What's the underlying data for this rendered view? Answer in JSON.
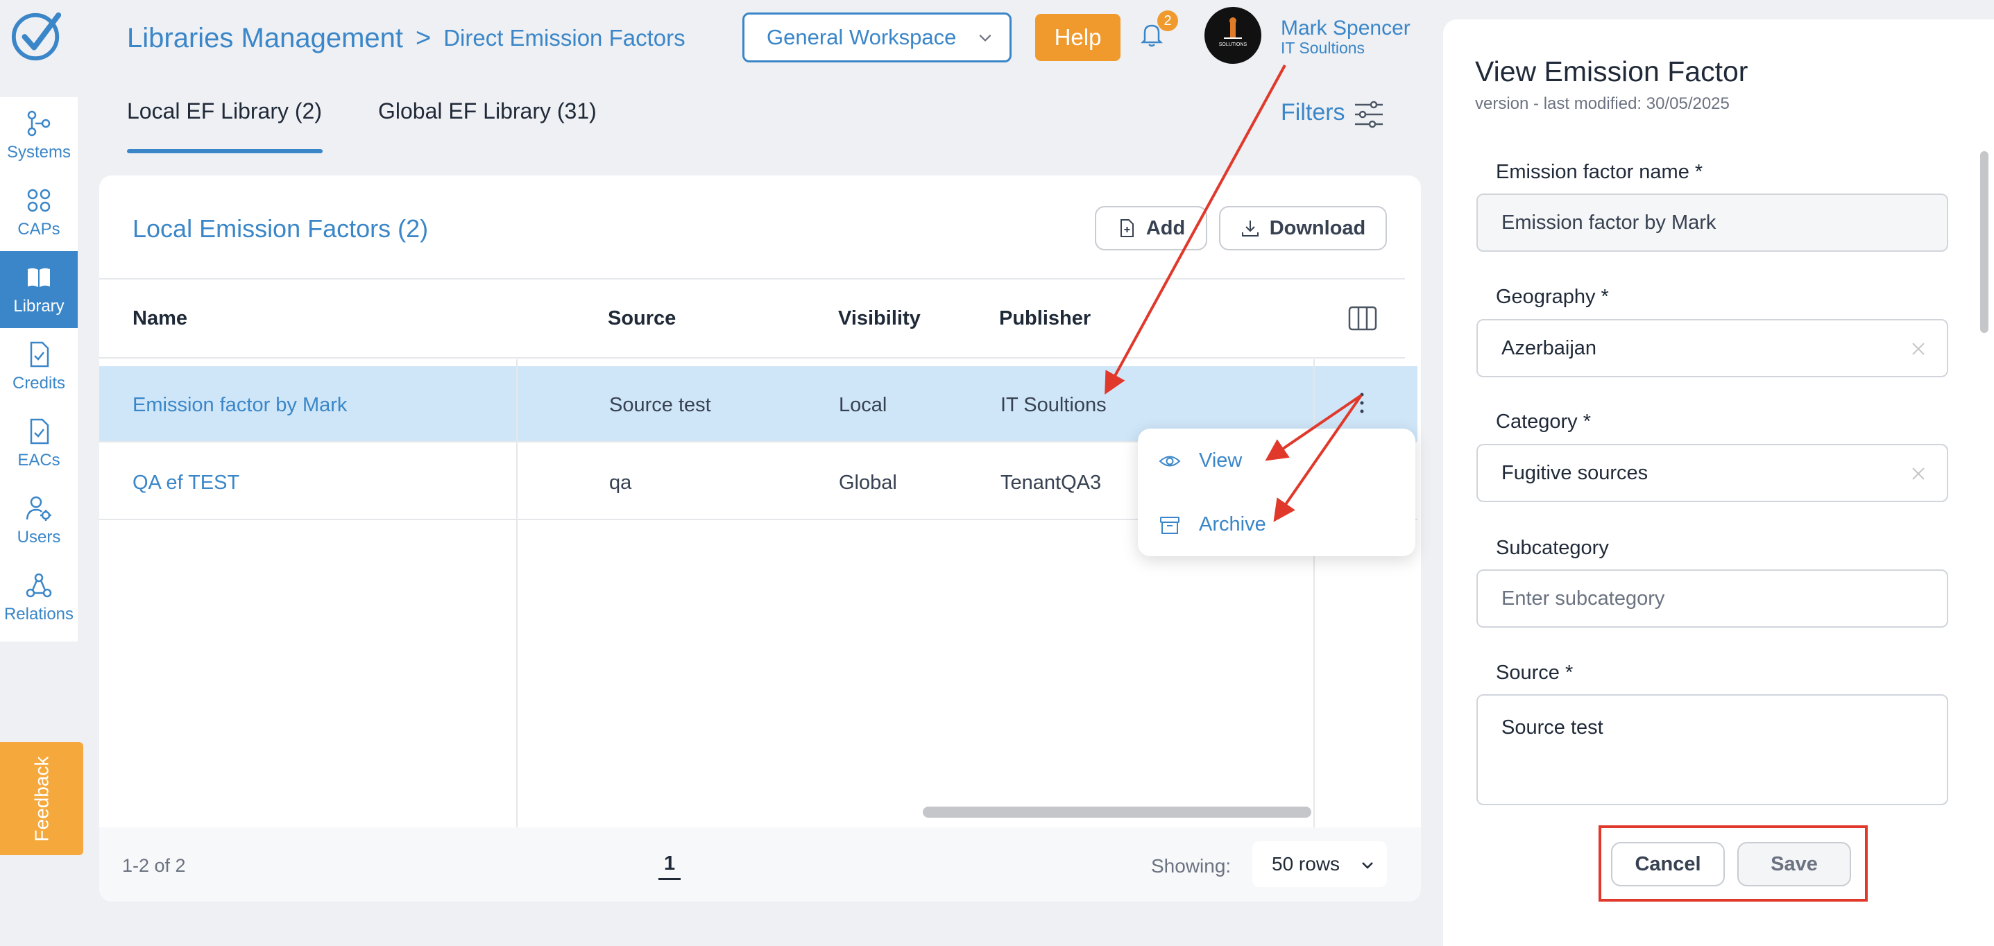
{
  "header": {
    "breadcrumb_root": "Libraries Management",
    "breadcrumb_sep": ">",
    "breadcrumb_current": "Direct Emission Factors",
    "workspace": "General Workspace",
    "help_label": "Help",
    "notification_count": "2",
    "user_name": "Mark Spencer",
    "user_org": "IT Soultions",
    "avatar_text": "SOLUTIONS"
  },
  "sidebar": {
    "items": [
      {
        "label": "Systems",
        "icon": "systems-icon"
      },
      {
        "label": "CAPs",
        "icon": "grid-icon"
      },
      {
        "label": "Library",
        "icon": "book-icon",
        "active": true
      },
      {
        "label": "Credits",
        "icon": "document-check-icon"
      },
      {
        "label": "EACs",
        "icon": "document-check-icon"
      },
      {
        "label": "Users",
        "icon": "user-gear-icon"
      },
      {
        "label": "Relations",
        "icon": "relations-icon"
      }
    ],
    "feedback_label": "Feedback"
  },
  "tabs": [
    {
      "label": "Local EF Library (2)",
      "active": true
    },
    {
      "label": "Global EF Library (31)",
      "active": false
    }
  ],
  "filters_label": "Filters",
  "card": {
    "title": "Local Emission Factors (2)",
    "add_label": "Add",
    "download_label": "Download",
    "columns": [
      "Name",
      "Source",
      "Visibility",
      "Publisher"
    ],
    "rows": [
      {
        "name": "Emission factor by Mark",
        "source": "Source test",
        "visibility": "Local",
        "publisher": "IT Soultions"
      },
      {
        "name": "QA ef TEST",
        "source": "qa",
        "visibility": "Global",
        "publisher": "TenantQA3"
      }
    ],
    "footer": {
      "range": "1-2 of 2",
      "page": "1",
      "showing_label": "Showing:",
      "rows_option": "50 rows"
    }
  },
  "context_menu": {
    "view_label": "View",
    "archive_label": "Archive"
  },
  "panel": {
    "title": "View Emission Factor",
    "subtitle": "version - last modified: 30/05/2025",
    "fields": {
      "name_label": "Emission factor name *",
      "name_value": "Emission factor by Mark",
      "geography_label": "Geography *",
      "geography_value": "Azerbaijan",
      "category_label": "Category *",
      "category_value": "Fugitive sources",
      "subcategory_label": "Subcategory",
      "subcategory_placeholder": "Enter subcategory",
      "source_label": "Source *",
      "source_value": "Source test"
    },
    "cancel_label": "Cancel",
    "save_label": "Save"
  },
  "colors": {
    "accent": "#3a86c8",
    "orange": "#f09a2d",
    "selected_row": "#cfe6f8",
    "annotation_red": "#e0392b"
  }
}
